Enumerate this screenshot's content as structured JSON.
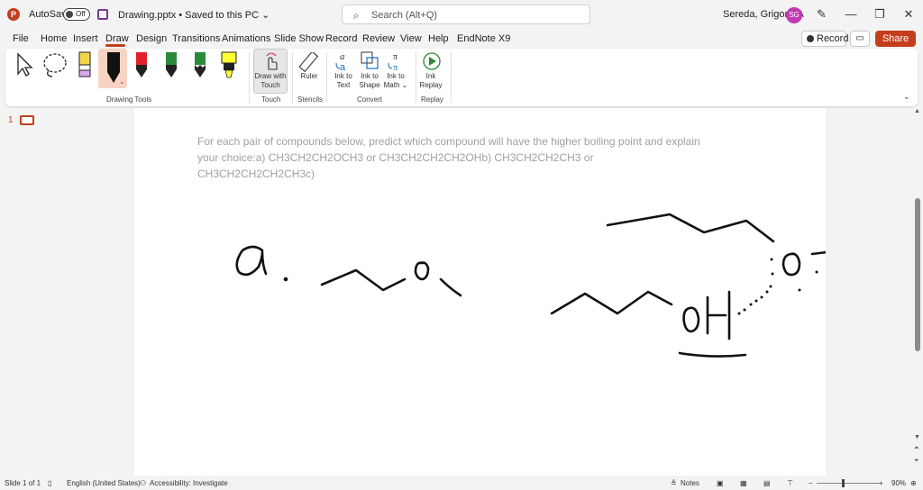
{
  "titlebar": {
    "app_logo": "P",
    "autosave_label": "AutoSave",
    "autosave_state": "Off",
    "doc_title": "Drawing.pptx • Saved to this PC ⌄",
    "search_placeholder": "Search (Alt+Q)",
    "user_name": "Sereda, Grigoriy A",
    "avatar_initials": "SG",
    "minimize": "—",
    "restore": "❐",
    "close": "✕"
  },
  "menu": {
    "tabs": [
      "File",
      "Home",
      "Insert",
      "Draw",
      "Design",
      "Transitions",
      "Animations",
      "Slide Show",
      "Record",
      "Review",
      "View",
      "Help",
      "EndNote X9"
    ],
    "active_tab": "Draw",
    "record_label": "Record",
    "share_label": "Share"
  },
  "ribbon": {
    "groups": {
      "drawing_tools": "Drawing Tools",
      "touch": "Touch",
      "stencils": "Stencils",
      "convert": "Convert",
      "replay": "Replay"
    },
    "draw_with_touch": "Draw with Touch",
    "ruler": "Ruler",
    "ink_to_text": "Ink to Text",
    "ink_to_shape": "Ink to Shape",
    "ink_to_math": "Ink to Math ⌄",
    "ink_replay": "Ink Replay",
    "pen_colors": [
      "#d8a8e8",
      "#111111",
      "#e0202a",
      "#2a8a3a",
      "#2a8a3a",
      "#ffff33"
    ]
  },
  "thumbnails": {
    "slide_number": "1"
  },
  "slide": {
    "prompt_text": "For each pair of compounds below, predict which compound will have the higher boiling point and explain your choice:a) CH3CH2CH2OCH3 or CH3CH2CH2CH2OHb) CH3CH2CH2CH3 or CH3CH2CH2CH2CH3c)"
  },
  "status": {
    "slide_count": "Slide 1 of 1",
    "language": "English (United States)",
    "accessibility": "Accessibility: Investigate",
    "notes": "Notes",
    "zoom": "90%"
  },
  "colors": {
    "accent": "#c43e1c",
    "ink": "#111111",
    "prompt_gray": "#a0a0a0"
  }
}
